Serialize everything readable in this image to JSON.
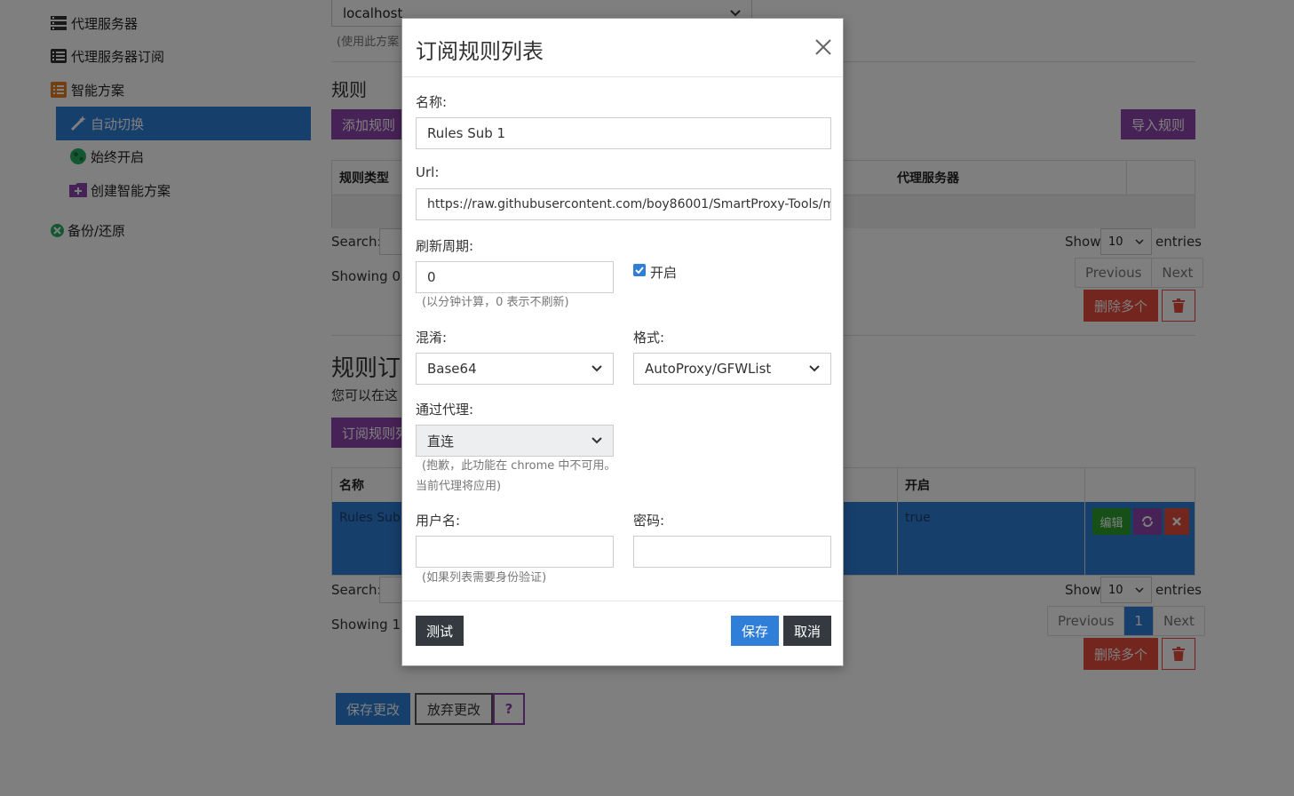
{
  "sidebar": {
    "items": [
      {
        "label": "代理服务器",
        "icon": "server-icon"
      },
      {
        "label": "代理服务器订阅",
        "icon": "list-icon"
      },
      {
        "label": "智能方案",
        "icon": "tasks-icon"
      }
    ],
    "sub_items": [
      {
        "label": "自动切换",
        "icon": "magic-wand-icon",
        "active": true
      },
      {
        "label": "始终开启",
        "icon": "globe-icon"
      },
      {
        "label": "创建智能方案",
        "icon": "folder-plus-icon"
      }
    ],
    "backup": {
      "label": "备份/还原",
      "icon": "backup-icon"
    }
  },
  "main": {
    "default_server": "localhost",
    "default_hint": "(使用此方案",
    "rules_title": "规则",
    "add_rule": "添加规则",
    "import_rules": "导入规则",
    "rules_table": {
      "col_type": "规则类型",
      "col_server": "代理服务器"
    },
    "search_label": "Search:",
    "show_label": "Show",
    "entries_label": "entries",
    "page_size": "10",
    "showing_rules": "Showing 0 t",
    "previous": "Previous",
    "next": "Next",
    "delete_multi": "删除多个",
    "subs_title": "规则订",
    "subs_desc": "您可以在这",
    "subs_add": "订阅规则列",
    "subs_table": {
      "col_name": "名称",
      "col_enabled": "开启"
    },
    "sub_row": {
      "name": "Rules Sub",
      "enabled": "true",
      "edit": "编辑"
    },
    "showing_subs": "Showing 1 t",
    "current_page": "1",
    "save_changes": "保存更改",
    "discard_changes": "放弃更改",
    "help": "?"
  },
  "modal": {
    "title": "订阅规则列表",
    "name_label": "名称:",
    "name_value": "Rules Sub 1",
    "url_label": "Url:",
    "url_value": "https://raw.githubusercontent.com/boy86001/SmartProxy-Tools/ma",
    "refresh_label": "刷新周期:",
    "refresh_value": "0",
    "refresh_help": "(以分钟计算，0 表示不刷新)",
    "enabled_label": "开启",
    "obfuscation_label": "混淆:",
    "obfuscation_value": "Base64",
    "format_label": "格式:",
    "format_value": "AutoProxy/GFWList",
    "via_proxy_label": "通过代理:",
    "via_proxy_value": "直连",
    "via_proxy_help_1": "(抱歉，此功能在 chrome 中不可用。",
    "via_proxy_help_2": "当前代理将应用)",
    "username_label": "用户名:",
    "password_label": "密码:",
    "auth_help": "(如果列表需要身份验证)",
    "test_button": "测试",
    "save_button": "保存",
    "cancel_button": "取消"
  },
  "colors": {
    "primary": "#2f7ed8",
    "purple": "#8e44ad",
    "danger": "#e74c3c",
    "dark": "#343a40",
    "success": "#2ca02c"
  }
}
